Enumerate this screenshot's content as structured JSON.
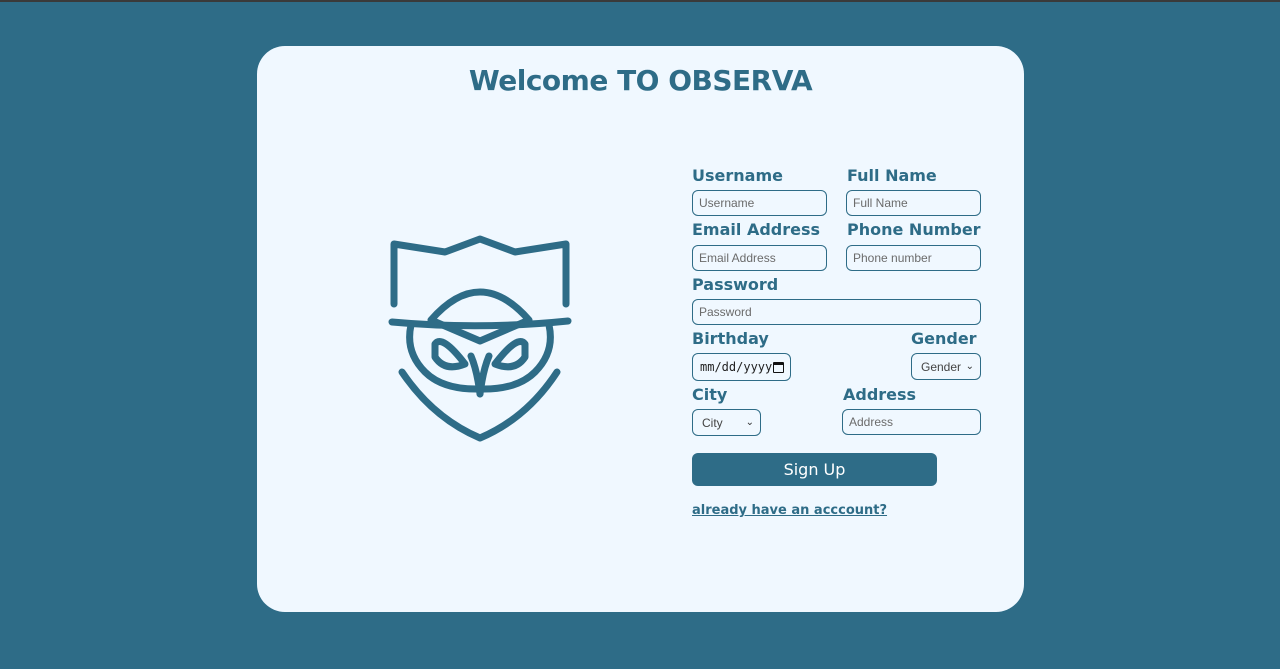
{
  "title": "Welcome TO OBSERVA",
  "logo": {
    "icon": "owl-shield-logo",
    "color": "#2e6c87"
  },
  "form": {
    "username": {
      "label": "Username",
      "placeholder": "Username"
    },
    "full_name": {
      "label": "Full Name",
      "placeholder": "Full Name"
    },
    "email": {
      "label": "Email Address",
      "placeholder": "Email Address"
    },
    "phone": {
      "label": "Phone Number",
      "placeholder": "Phone number"
    },
    "password": {
      "label": "Password",
      "placeholder": "Password"
    },
    "birthday": {
      "label": "Birthday",
      "value": "mm/dd/yyyy"
    },
    "gender": {
      "label": "Gender",
      "selected": "Gender"
    },
    "city": {
      "label": "City",
      "selected": "City"
    },
    "address": {
      "label": "Address",
      "placeholder": "Address"
    },
    "submit_label": "Sign Up",
    "login_link": "already have an acccount?"
  },
  "colors": {
    "background": "#2e6c87",
    "card": "#f0f8ff",
    "accent": "#2e6c87"
  }
}
